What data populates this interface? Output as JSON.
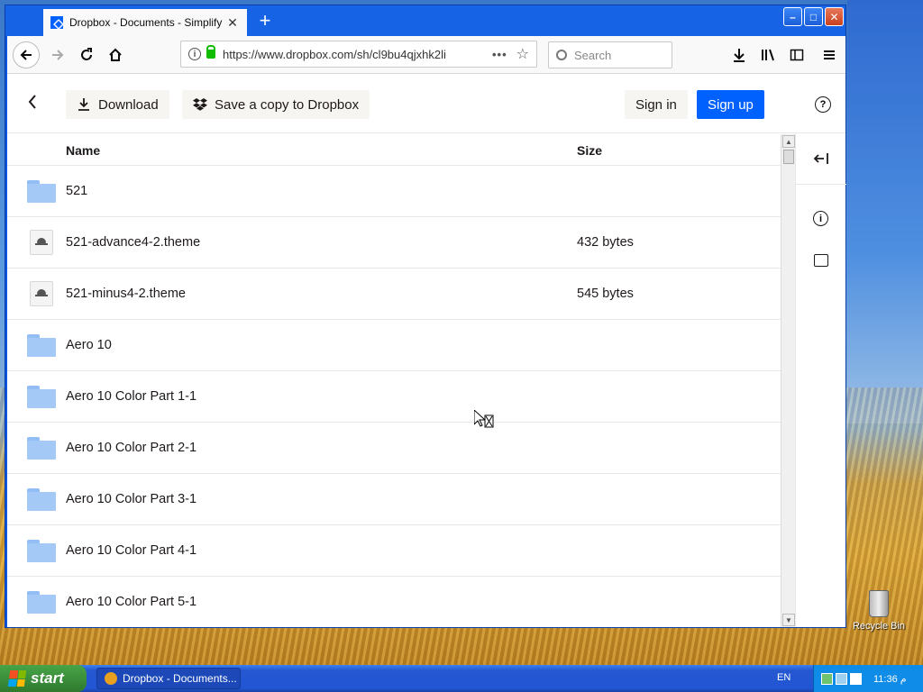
{
  "browser": {
    "tab_title": "Dropbox - Documents - Simplify yo",
    "tab_close": "✕",
    "new_tab": "+",
    "url": "https://www.dropbox.com/sh/cl9bu4qjxhk2li",
    "url_more": "•••",
    "search_placeholder": "Search",
    "window_buttons": {
      "minimize": "–",
      "maximize": "□",
      "close": "✕"
    }
  },
  "actionbar": {
    "download_label": "Download",
    "save_copy_label": "Save a copy to Dropbox",
    "sign_in_label": "Sign in",
    "sign_up_label": "Sign up",
    "help_glyph": "?"
  },
  "filelist": {
    "headers": {
      "name": "Name",
      "size": "Size"
    },
    "rows": [
      {
        "type": "folder",
        "name": "521",
        "size": ""
      },
      {
        "type": "theme",
        "name": "521-advance4-2.theme",
        "size": "432 bytes"
      },
      {
        "type": "theme",
        "name": "521-minus4-2.theme",
        "size": "545 bytes"
      },
      {
        "type": "folder",
        "name": "Aero 10",
        "size": ""
      },
      {
        "type": "folder",
        "name": "Aero 10 Color Part 1-1",
        "size": ""
      },
      {
        "type": "folder",
        "name": "Aero 10 Color Part 2-1",
        "size": ""
      },
      {
        "type": "folder",
        "name": "Aero 10 Color Part 3-1",
        "size": ""
      },
      {
        "type": "folder",
        "name": "Aero 10 Color Part 4-1",
        "size": ""
      },
      {
        "type": "folder",
        "name": "Aero 10 Color Part 5-1",
        "size": ""
      }
    ]
  },
  "desktop": {
    "recycle_bin_label": "Recycle Bin"
  },
  "taskbar": {
    "start_label": "start",
    "task_label": "Dropbox - Documents...",
    "language": "EN",
    "clock": "11:36 م"
  },
  "colors": {
    "dropbox_blue": "#0061fe",
    "folder_blue": "#a5c9f7",
    "xp_taskbar": "#2457d0",
    "xp_start_green": "#3b8f3b"
  }
}
